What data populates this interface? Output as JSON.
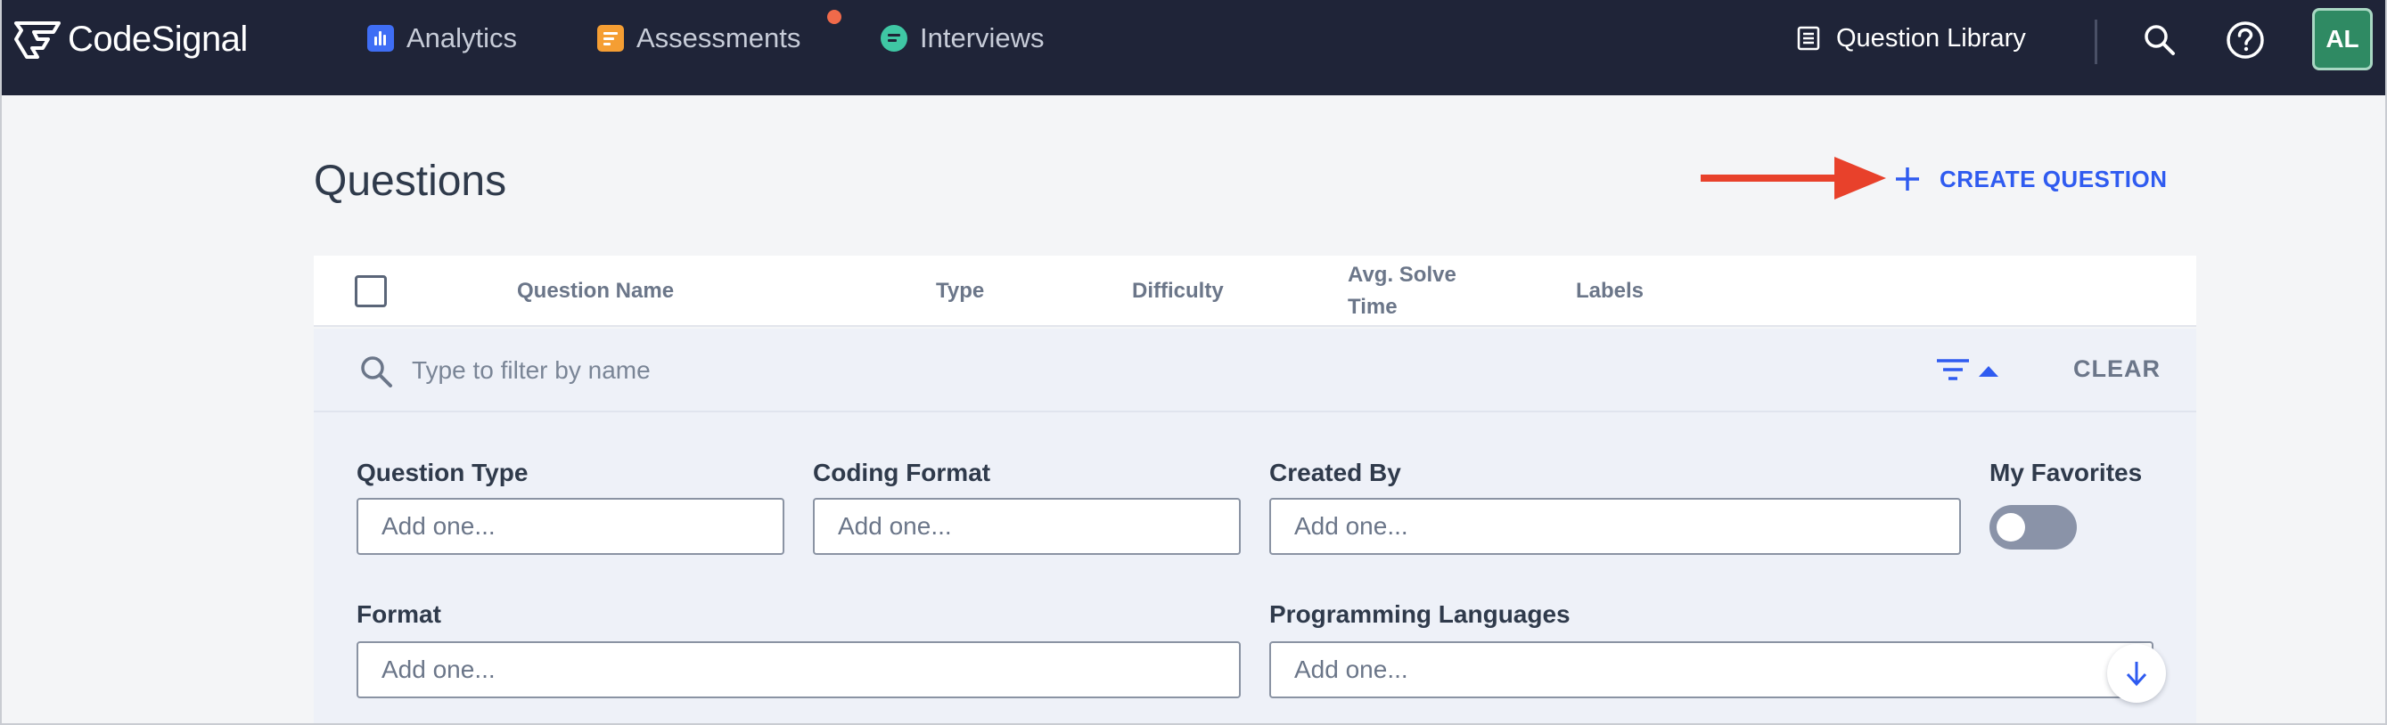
{
  "app": {
    "brand": "CodeSignal"
  },
  "nav": {
    "items": [
      {
        "label": "Analytics",
        "icon": "analytics-icon",
        "color": "#3f6ef5"
      },
      {
        "label": "Assessments",
        "icon": "assessments-icon",
        "color": "#f59e33",
        "has_notification": true
      },
      {
        "label": "Interviews",
        "icon": "interviews-icon",
        "color": "#3fc7a4"
      }
    ],
    "library_label": "Question Library",
    "avatar_initials": "AL",
    "avatar_color": "#2f8a63"
  },
  "page": {
    "title": "Questions",
    "create_label": "CREATE QUESTION",
    "accent_color": "#2f5bf0",
    "annotation_arrow_color": "#e8412b"
  },
  "table": {
    "columns": [
      "Question Name",
      "Type",
      "Difficulty",
      "Avg. Solve",
      "Time",
      "Labels"
    ]
  },
  "filter": {
    "placeholder": "Type to filter by name",
    "clear_label": "CLEAR"
  },
  "filters": {
    "question_type": {
      "label": "Question Type",
      "placeholder": "Add one..."
    },
    "coding_format": {
      "label": "Coding Format",
      "placeholder": "Add one..."
    },
    "created_by": {
      "label": "Created By",
      "placeholder": "Add one..."
    },
    "my_favorites": {
      "label": "My Favorites",
      "enabled": false
    },
    "format": {
      "label": "Format",
      "placeholder": "Add one..."
    },
    "programming_languages": {
      "label": "Programming Languages",
      "placeholder": "Add one..."
    }
  }
}
